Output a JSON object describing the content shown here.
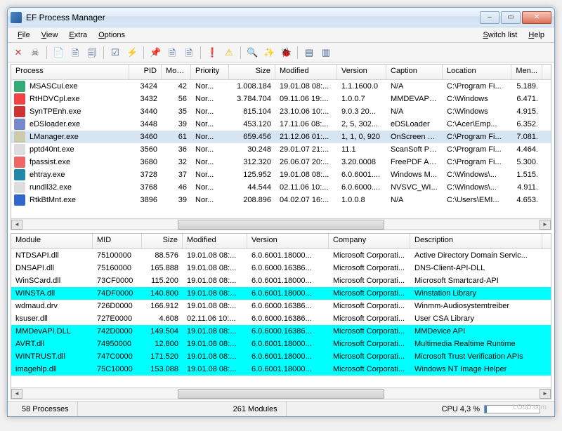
{
  "window": {
    "title": "EF Process Manager"
  },
  "menu": {
    "file": "File",
    "view": "View",
    "extra": "Extra",
    "options": "Options",
    "switch": "Switch list",
    "help": "Help"
  },
  "toolbar_icons": [
    "close-x",
    "skull",
    "sep",
    "document",
    "page-refresh",
    "page-find",
    "sep",
    "checkbox",
    "lightning",
    "sep",
    "pin",
    "doc-plus",
    "doc-refresh",
    "sep",
    "exclaim",
    "warning",
    "sep",
    "magnifier",
    "wand",
    "bug",
    "sep",
    "layout-1",
    "layout-2"
  ],
  "top": {
    "cols": [
      "Process",
      "PID",
      "Mod...",
      "Priority",
      "Size",
      "Modified",
      "Version",
      "Caption",
      "Location",
      "Men..."
    ],
    "rows": [
      {
        "ico": "#3a7",
        "cells": [
          "MSASCui.exe",
          "3424",
          "42",
          "Nor...",
          "1.008.184",
          "19.01.08  08:...",
          "1.1.1600.0",
          "N/A",
          "C:\\Program Fi...",
          "5.189."
        ]
      },
      {
        "ico": "#e44",
        "cells": [
          "RtHDVCpl.exe",
          "3432",
          "56",
          "Nor...",
          "3.784.704",
          "09.11.06  19:...",
          "1.0.0.7",
          "MMDEVAPI ...",
          "C:\\Windows",
          "6.471."
        ]
      },
      {
        "ico": "#c33",
        "cells": [
          "SynTPEnh.exe",
          "3440",
          "35",
          "Nor...",
          "815.104",
          "23.10.06  10:...",
          "9.0.3  20...",
          "N/A",
          "C:\\Windows",
          "4.915."
        ]
      },
      {
        "ico": "#78c",
        "cells": [
          "eDSloader.exe",
          "3448",
          "39",
          "Nor...",
          "453.120",
          "17.11.06  08:...",
          "2, 5, 302...",
          "eDSLoader",
          "C:\\Acer\\Emp...",
          "6.352."
        ]
      },
      {
        "sel": true,
        "ico": "#cca",
        "cells": [
          "LManager.exe",
          "3460",
          "61",
          "Nor...",
          "659.456",
          "21.12.06  01:...",
          "1, 1, 0, 920",
          "OnScreen D...",
          "C:\\Program Fi...",
          "7.081."
        ]
      },
      {
        "ico": "#ddd",
        "cells": [
          "pptd40nt.exe",
          "3560",
          "36",
          "Nor...",
          "30.248",
          "29.01.07  21:...",
          "11.1",
          "ScanSoft Pa...",
          "C:\\Program Fi...",
          "4.464."
        ]
      },
      {
        "ico": "#e66",
        "cells": [
          "fpassist.exe",
          "3680",
          "32",
          "Nor...",
          "312.320",
          "26.06.07  20:...",
          "3.20.0008",
          "FreePDF Ass...",
          "C:\\Program Fi...",
          "5.300."
        ]
      },
      {
        "ico": "#28a",
        "cells": [
          "ehtray.exe",
          "3728",
          "37",
          "Nor...",
          "125.952",
          "19.01.08  08:...",
          "6.0.6001....",
          "Windows M...",
          "C:\\Windows\\...",
          "1.515."
        ]
      },
      {
        "ico": "#ddd",
        "cells": [
          "rundll32.exe",
          "3768",
          "46",
          "Nor...",
          "44.544",
          "02.11.06  10:...",
          "6.0.6000....",
          "NVSVC_WI...",
          "C:\\Windows\\...",
          "4.911."
        ]
      },
      {
        "ico": "#36c",
        "cells": [
          "RtkBtMnt.exe",
          "3896",
          "39",
          "Nor...",
          "208.896",
          "04.02.07  16:...",
          "1.0.0.8",
          "N/A",
          "C:\\Users\\EMI...",
          "4.653."
        ]
      }
    ]
  },
  "bottom": {
    "cols": [
      "Module",
      "MID",
      "Size",
      "Modified",
      "Version",
      "Company",
      "Description"
    ],
    "rows": [
      {
        "cells": [
          "NTDSAPI.dll",
          "75100000",
          "88.576",
          "19.01.08  08:...",
          "6.0.6001.18000...",
          "Microsoft Corporati...",
          "Active Directory Domain Servic..."
        ]
      },
      {
        "cells": [
          "DNSAPI.dll",
          "75160000",
          "165.888",
          "19.01.08  08:...",
          "6.0.6000.16386...",
          "Microsoft Corporati...",
          "DNS-Client-API-DLL"
        ]
      },
      {
        "cells": [
          "WinSCard.dll",
          "73CF0000",
          "115.200",
          "19.01.08  08:...",
          "6.0.6001.18000...",
          "Microsoft Corporati...",
          "Microsoft Smartcard-API"
        ]
      },
      {
        "hi": true,
        "cells": [
          "WINSTA.dll",
          "74DF0000",
          "140.800",
          "19.01.08  08:...",
          "6.0.6001.18000...",
          "Microsoft Corporati...",
          "Winstation Library"
        ]
      },
      {
        "cells": [
          "wdmaud.drv",
          "726D0000",
          "166.912",
          "19.01.08  08:...",
          "6.0.6000.16386...",
          "Microsoft Corporati...",
          "Winmm-Audiosystemtreiber"
        ]
      },
      {
        "cells": [
          "ksuser.dll",
          "727E0000",
          "4.608",
          "02.11.06  10:...",
          "6.0.6000.16386...",
          "Microsoft Corporati...",
          "User CSA Library"
        ]
      },
      {
        "hi": true,
        "cells": [
          "MMDevAPI.DLL",
          "742D0000",
          "149.504",
          "19.01.08  08:...",
          "6.0.6000.16386...",
          "Microsoft Corporati...",
          "MMDevice API"
        ]
      },
      {
        "hi": true,
        "cells": [
          "AVRT.dll",
          "74950000",
          "12.800",
          "19.01.08  08:...",
          "6.0.6001.18000...",
          "Microsoft Corporati...",
          "Multimedia Realtime Runtime"
        ]
      },
      {
        "hi": true,
        "cells": [
          "WINTRUST.dll",
          "747C0000",
          "171.520",
          "19.01.08  08:...",
          "6.0.6001.18000...",
          "Microsoft Corporati...",
          "Microsoft Trust Verification APIs"
        ]
      },
      {
        "hi": true,
        "cells": [
          "imagehlp.dll",
          "75C10000",
          "153.088",
          "19.01.08  08:...",
          "6.0.6001.18000...",
          "Microsoft Corporati...",
          "Windows NT Image Helper"
        ]
      }
    ]
  },
  "status": {
    "procs": "58 Processes",
    "mods": "261 Modules",
    "cpu": "CPU 4,3 %"
  },
  "watermark": "LO4D.com"
}
